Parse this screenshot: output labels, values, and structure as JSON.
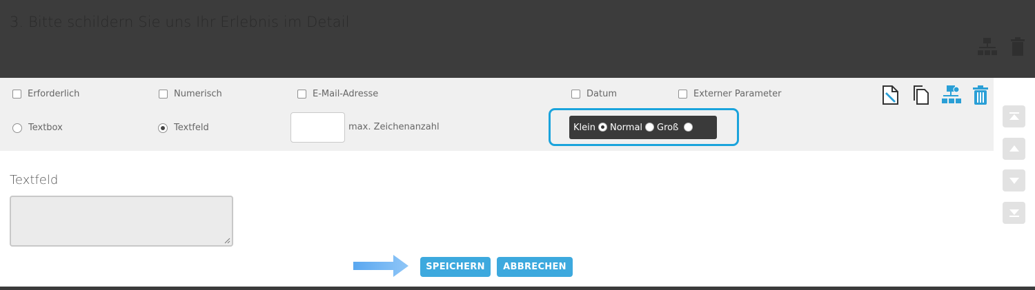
{
  "question": {
    "title": "3. Bitte schildern Sie uns Ihr Erlebnis im Detail"
  },
  "options": {
    "required_label": "Erforderlich",
    "numeric_label": "Numerisch",
    "email_label": "E-Mail-Adresse",
    "date_label": "Datum",
    "external_param_label": "Externer Parameter",
    "textbox_label": "Textbox",
    "textfield_label": "Textfeld",
    "max_chars_label": "max. Zeichenanzahl",
    "max_chars_value": ""
  },
  "size": {
    "small_label": "Klein",
    "normal_label": "Normal",
    "large_label": "Groß",
    "selected": "Klein"
  },
  "preview": {
    "field_label": "Textfeld",
    "field_value": ""
  },
  "actions": {
    "save_label": "SPEICHERN",
    "cancel_label": "ABBRECHEN"
  },
  "colors": {
    "accent": "#3da9de",
    "highlight_border": "#1aa3dc"
  },
  "icons": [
    "edit-icon",
    "copy-icon",
    "logic-tree-icon",
    "trash-icon",
    "move-top-icon",
    "move-up-icon",
    "move-down-icon",
    "move-bottom-icon",
    "arrow-right-icon"
  ]
}
